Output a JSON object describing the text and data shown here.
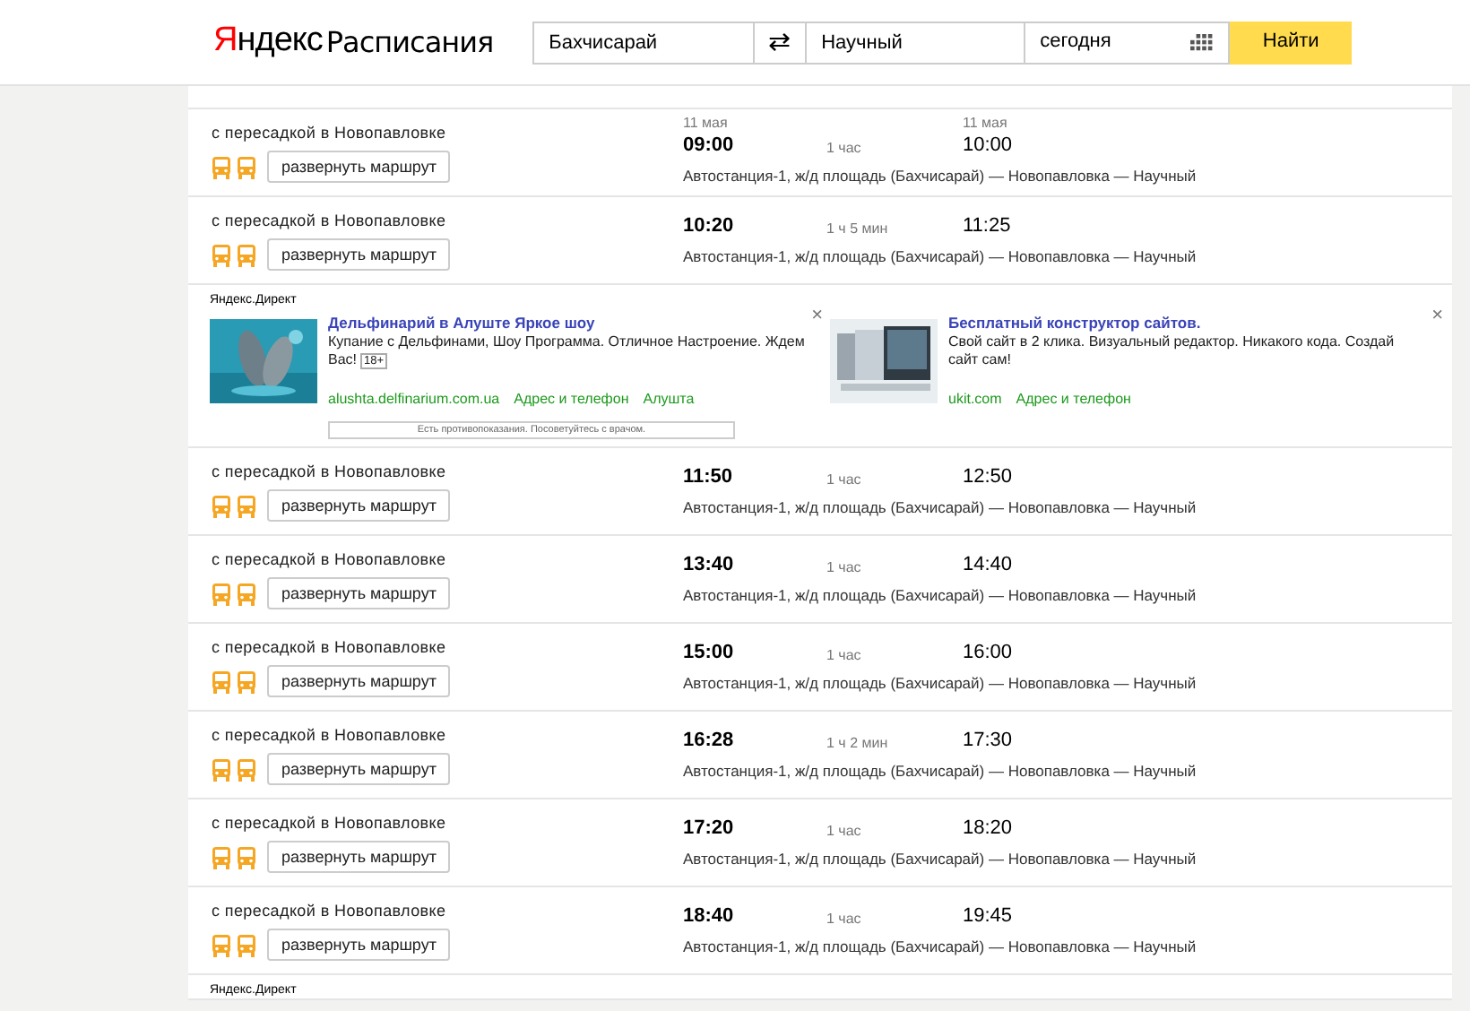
{
  "header": {
    "logo_brand": "Яндекс",
    "logo_product": "Расписания",
    "from": "Бахчисарай",
    "swap": "⇄",
    "to": "Научный",
    "date": "сегодня",
    "search_button": "Найти"
  },
  "sections": [
    {
      "kind": "trip",
      "transfer": "с пересадкой в Новопавловке",
      "expand_button": "развернуть маршрут",
      "departure_date": "11 мая",
      "departure": "09:00",
      "duration": "1 час",
      "arrival_date": "11 мая",
      "arrival": "10:00",
      "route": "Автостанция-1, ж/д площадь (Бахчисарай) — Новопавловка — Научный"
    },
    {
      "kind": "trip",
      "transfer": "с пересадкой в Новопавловке",
      "expand_button": "развернуть маршрут",
      "departure": "10:20",
      "duration": "1 ч 5 мин",
      "arrival": "11:25",
      "route": "Автостанция-1, ж/д площадь (Бахчисарай) — Новопавловка — Научный"
    },
    {
      "kind": "ads",
      "label": "Яндекс.Директ",
      "ads": [
        {
          "title": "Дельфинарий в Алуште Яркое шоу",
          "text": "Купание с Дельфинами, Шоу Программа. Отличное Настроение. Ждем Вас!",
          "age": "18+",
          "close": "×",
          "links": [
            "alushta.delfinarium.com.ua",
            "Адрес и телефон",
            "Алушта"
          ],
          "disclaimer": "Есть противопоказания. Посоветуйтесь с врачом."
        },
        {
          "title": "Бесплатный конструктор сайтов.",
          "text": "Свой сайт в 2 клика. Визуальный редактор. Никакого кода. Создай сайт сам!",
          "close": "×",
          "links": [
            "ukit.com",
            "Адрес и телефон"
          ]
        }
      ]
    },
    {
      "kind": "trip",
      "transfer": "с пересадкой в Новопавловке",
      "expand_button": "развернуть маршрут",
      "departure": "11:50",
      "duration": "1 час",
      "arrival": "12:50",
      "route": "Автостанция-1, ж/д площадь (Бахчисарай) — Новопавловка — Научный"
    },
    {
      "kind": "trip",
      "transfer": "с пересадкой в Новопавловке",
      "expand_button": "развернуть маршрут",
      "departure": "13:40",
      "duration": "1 час",
      "arrival": "14:40",
      "route": "Автостанция-1, ж/д площадь (Бахчисарай) — Новопавловка — Научный"
    },
    {
      "kind": "trip",
      "transfer": "с пересадкой в Новопавловке",
      "expand_button": "развернуть маршрут",
      "departure": "15:00",
      "duration": "1 час",
      "arrival": "16:00",
      "route": "Автостанция-1, ж/д площадь (Бахчисарай) — Новопавловка — Научный"
    },
    {
      "kind": "trip",
      "transfer": "с пересадкой в Новопавловке",
      "expand_button": "развернуть маршрут",
      "departure": "16:28",
      "duration": "1 ч 2 мин",
      "arrival": "17:30",
      "route": "Автостанция-1, ж/д площадь (Бахчисарай) — Новопавловка — Научный"
    },
    {
      "kind": "trip",
      "transfer": "с пересадкой в Новопавловке",
      "expand_button": "развернуть маршрут",
      "departure": "17:20",
      "duration": "1 час",
      "arrival": "18:20",
      "route": "Автостанция-1, ж/д площадь (Бахчисарай) — Новопавловка — Научный"
    },
    {
      "kind": "trip",
      "transfer": "с пересадкой в Новопавловке",
      "expand_button": "развернуть маршрут",
      "departure": "18:40",
      "duration": "1 час",
      "arrival": "19:45",
      "route": "Автостанция-1, ж/д площадь (Бахчисарай) — Новопавловка — Научный"
    },
    {
      "kind": "ads",
      "label": "Яндекс.Директ"
    }
  ]
}
